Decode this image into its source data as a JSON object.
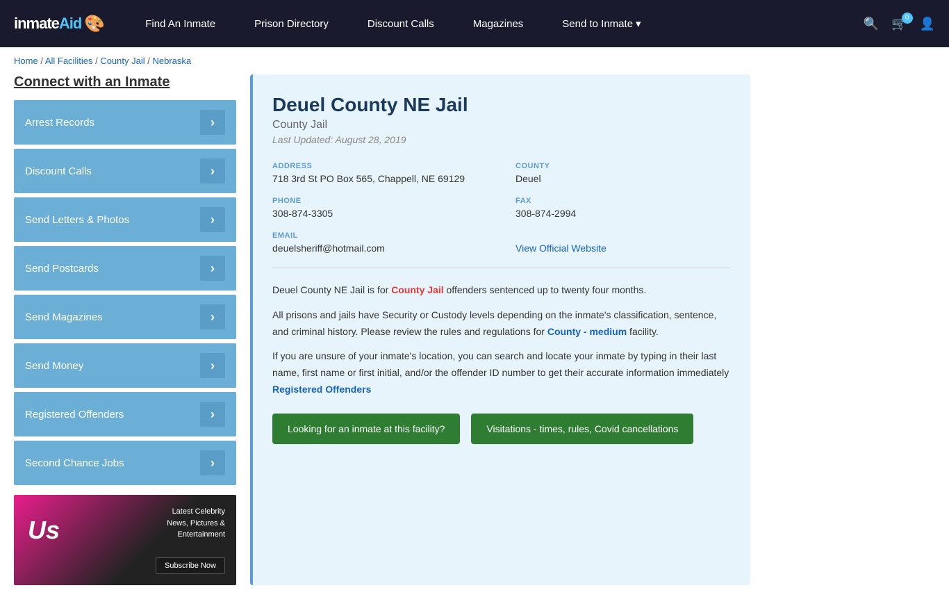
{
  "nav": {
    "logo": "inmateAid",
    "links": [
      {
        "label": "Find An Inmate",
        "id": "find-inmate"
      },
      {
        "label": "Prison Directory",
        "id": "prison-directory"
      },
      {
        "label": "Discount Calls",
        "id": "discount-calls"
      },
      {
        "label": "Magazines",
        "id": "magazines"
      },
      {
        "label": "Send to Inmate",
        "id": "send-to-inmate"
      }
    ],
    "cart_count": "0",
    "send_inmate_label": "Send to Inmate"
  },
  "breadcrumb": {
    "home": "Home",
    "all_facilities": "All Facilities",
    "county_jail": "County Jail",
    "state": "Nebraska"
  },
  "sidebar": {
    "title": "Connect with an Inmate",
    "items": [
      {
        "label": "Arrest Records",
        "id": "arrest-records"
      },
      {
        "label": "Discount Calls",
        "id": "discount-calls"
      },
      {
        "label": "Send Letters & Photos",
        "id": "send-letters"
      },
      {
        "label": "Send Postcards",
        "id": "send-postcards"
      },
      {
        "label": "Send Magazines",
        "id": "send-magazines"
      },
      {
        "label": "Send Money",
        "id": "send-money"
      },
      {
        "label": "Registered Offenders",
        "id": "registered-offenders"
      },
      {
        "label": "Second Chance Jobs",
        "id": "second-chance-jobs"
      }
    ]
  },
  "ad": {
    "logo": "Us",
    "headline": "Latest Celebrity",
    "line2": "News, Pictures &",
    "line3": "Entertainment",
    "button": "Subscribe Now"
  },
  "facility": {
    "name": "Deuel County NE Jail",
    "type": "County Jail",
    "updated": "Last Updated: August 28, 2019",
    "address_label": "ADDRESS",
    "address": "718 3rd St PO Box 565, Chappell, NE 69129",
    "county_label": "COUNTY",
    "county": "Deuel",
    "phone_label": "PHONE",
    "phone": "308-874-3305",
    "fax_label": "FAX",
    "fax": "308-874-2994",
    "email_label": "EMAIL",
    "email": "deuelsheriff@hotmail.com",
    "website_label": "View Official Website",
    "description1": "Deuel County NE Jail is for ",
    "desc1_link": "County Jail",
    "desc1_end": " offenders sentenced up to twenty four months.",
    "description2": "All prisons and jails have Security or Custody levels depending on the inmate's classification, sentence, and criminal history. Please review the rules and regulations for ",
    "desc2_link": "County - medium",
    "desc2_end": " facility.",
    "description3": "If you are unsure of your inmate's location, you can search and locate your inmate by typing in their last name, first name or first initial, and/or the offender ID number to get their accurate information immediately ",
    "desc3_link": "Registered Offenders",
    "btn1": "Looking for an inmate at this facility?",
    "btn2": "Visitations - times, rules, Covid cancellations"
  }
}
